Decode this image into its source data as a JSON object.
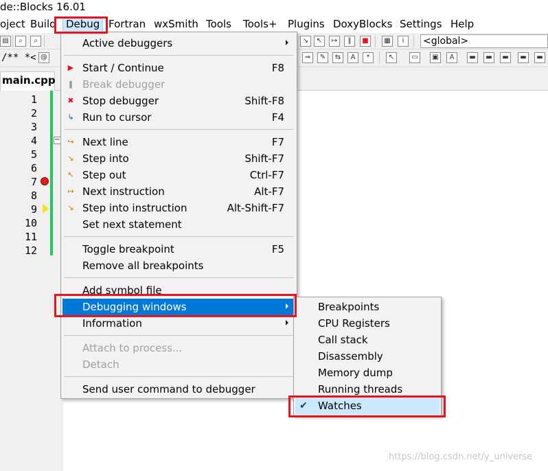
{
  "window": {
    "title": "de::Blocks 16.01"
  },
  "menubar": [
    {
      "id": "project",
      "label": "oject"
    },
    {
      "id": "build",
      "label": "Build"
    },
    {
      "id": "debug",
      "label": "Debug"
    },
    {
      "id": "fortran",
      "label": "Fortran"
    },
    {
      "id": "wxsmith",
      "label": "wxSmith"
    },
    {
      "id": "tools",
      "label": "Tools"
    },
    {
      "id": "toolsplus",
      "label": "Tools+"
    },
    {
      "id": "plugins",
      "label": "Plugins"
    },
    {
      "id": "doxyblocks",
      "label": "DoxyBlocks"
    },
    {
      "id": "settings",
      "label": "Settings"
    },
    {
      "id": "help",
      "label": "Help"
    }
  ],
  "toolbar": {
    "scope_combo": "<global>",
    "comment_text": "/** *<"
  },
  "editor": {
    "tab_label": "main.cpp",
    "line_numbers": [
      "1",
      "2",
      "3",
      "4",
      "5",
      "6",
      "7",
      "8",
      "9",
      "10",
      "11",
      "12"
    ]
  },
  "debug_menu": {
    "active_debuggers": "Active debuggers",
    "start_continue": "Start / Continue",
    "start_continue_sc": "F8",
    "break_debugger": "Break debugger",
    "stop_debugger": "Stop debugger",
    "stop_debugger_sc": "Shift-F8",
    "run_to_cursor": "Run to cursor",
    "run_to_cursor_sc": "F4",
    "next_line": "Next line",
    "next_line_sc": "F7",
    "step_into": "Step into",
    "step_into_sc": "Shift-F7",
    "step_out": "Step out",
    "step_out_sc": "Ctrl-F7",
    "next_instruction": "Next instruction",
    "next_instruction_sc": "Alt-F7",
    "step_into_instruction": "Step into instruction",
    "step_into_instruction_sc": "Alt-Shift-F7",
    "set_next_statement": "Set next statement",
    "toggle_breakpoint": "Toggle breakpoint",
    "toggle_breakpoint_sc": "F5",
    "remove_all_breakpoints": "Remove all breakpoints",
    "add_symbol_file": "Add symbol file",
    "debugging_windows": "Debugging windows",
    "information": "Information",
    "attach_to_process": "Attach to process...",
    "detach": "Detach",
    "send_user_command": "Send user command to debugger"
  },
  "debugging_windows_submenu": {
    "breakpoints": "Breakpoints",
    "cpu_registers": "CPU Registers",
    "call_stack": "Call stack",
    "disassembly": "Disassembly",
    "memory_dump": "Memory dump",
    "running_threads": "Running threads",
    "watches": "Watches",
    "check_mark": "✔"
  },
  "watermark": "https://blog.csdn.net/y_universe",
  "colors": {
    "highlight": "#0078d7",
    "annotation_red": "#e8131f",
    "change_bar": "#22c55e"
  }
}
